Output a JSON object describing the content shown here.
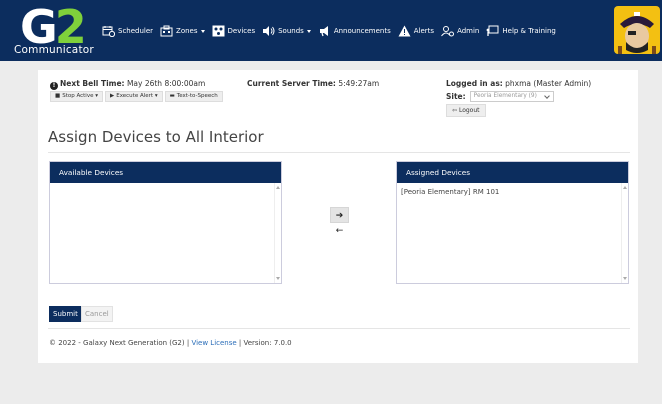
{
  "app": {
    "logo_main": "G",
    "logo_two": "2",
    "logo_sub": "Communicator"
  },
  "nav": {
    "items": [
      {
        "label": "Scheduler",
        "icon": "calendar-clock-icon",
        "dropdown": false
      },
      {
        "label": "Zones",
        "icon": "building-icon",
        "dropdown": true
      },
      {
        "label": "Devices",
        "icon": "devices-icon",
        "dropdown": false
      },
      {
        "label": "Sounds",
        "icon": "speaker-icon",
        "dropdown": true
      },
      {
        "label": "Announcements",
        "icon": "megaphone-icon",
        "dropdown": false
      },
      {
        "label": "Alerts",
        "icon": "warning-icon",
        "dropdown": false
      },
      {
        "label": "Admin",
        "icon": "users-gear-icon",
        "dropdown": false
      },
      {
        "label": "Help & Training",
        "icon": "help-board-icon",
        "dropdown": false
      }
    ]
  },
  "status": {
    "next_bell_label": "Next Bell Time:",
    "next_bell_value": "May 26th 8:00:00am",
    "server_time_label": "Current Server Time:",
    "server_time_value": "5:49:27am",
    "logged_in_label": "Logged in as:",
    "logged_in_value": "phxma (Master Admin)",
    "site_label": "Site:",
    "site_value": "Peoria Elementary (9)",
    "logout_label": "Logout"
  },
  "bell_actions": {
    "stop_active": "Stop Active",
    "execute_alert": "Execute Alert",
    "text_to_speech": "Text-to-Speech"
  },
  "page": {
    "title": "Assign Devices to All Interior"
  },
  "available": {
    "header": "Available Devices",
    "items": []
  },
  "assigned": {
    "header": "Assigned Devices",
    "items": [
      "[Peoria Elementary] RM 101"
    ]
  },
  "transfer": {
    "move_right": "➔",
    "move_left": "←"
  },
  "form": {
    "submit": "Submit",
    "cancel": "Cancel"
  },
  "footer": {
    "copyright": "© 2022 - Galaxy Next Generation (G2) |",
    "license_link": "View License",
    "version": "| Version: 7.0.0"
  },
  "colors": {
    "navbar": "#0c2d5e",
    "accent_green": "#7fd13b",
    "link": "#2a6db8",
    "mascot_bg": "#f3c012"
  }
}
